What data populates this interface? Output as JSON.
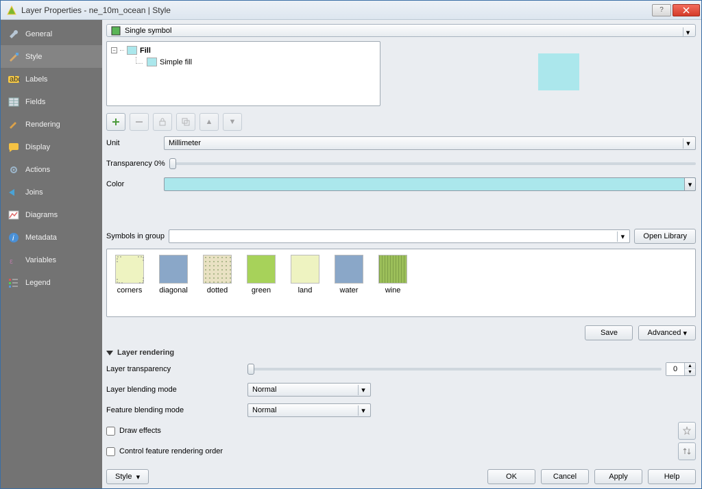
{
  "window": {
    "title": "Layer Properties - ne_10m_ocean | Style"
  },
  "sidebar": {
    "items": [
      {
        "label": "General"
      },
      {
        "label": "Style"
      },
      {
        "label": "Labels"
      },
      {
        "label": "Fields"
      },
      {
        "label": "Rendering"
      },
      {
        "label": "Display"
      },
      {
        "label": "Actions"
      },
      {
        "label": "Joins"
      },
      {
        "label": "Diagrams"
      },
      {
        "label": "Metadata"
      },
      {
        "label": "Variables"
      },
      {
        "label": "Legend"
      }
    ],
    "active_index": 1
  },
  "renderer": {
    "type": "Single symbol"
  },
  "tree": {
    "root": "Fill",
    "child": "Simple fill"
  },
  "colors": {
    "ocean": "#abe7ec"
  },
  "form": {
    "unit_label": "Unit",
    "unit_value": "Millimeter",
    "transparency_label": "Transparency 0%",
    "color_label": "Color"
  },
  "symbolsGroup": {
    "label": "Symbols in group",
    "openLibrary": "Open Library",
    "items": [
      {
        "name": "corners",
        "bg": "#eef3c1",
        "pattern": "corners"
      },
      {
        "name": "diagonal",
        "bg": "#8aa7c8",
        "pattern": ""
      },
      {
        "name": "dotted",
        "bg": "#e9e1c3",
        "pattern": "dots"
      },
      {
        "name": "green",
        "bg": "#a7d25a",
        "pattern": ""
      },
      {
        "name": "land",
        "bg": "#eef3c1",
        "pattern": ""
      },
      {
        "name": "water",
        "bg": "#8aa7c8",
        "pattern": ""
      },
      {
        "name": "wine",
        "bg": "#9cbf5a",
        "pattern": "lines"
      }
    ]
  },
  "buttons": {
    "save": "Save",
    "advanced": "Advanced"
  },
  "layerRendering": {
    "header": "Layer rendering",
    "transparency_label": "Layer transparency",
    "transparency_value": "0",
    "blend_label": "Layer blending mode",
    "blend_value": "Normal",
    "feat_blend_label": "Feature blending mode",
    "feat_blend_value": "Normal",
    "draw_effects": "Draw effects",
    "control_order": "Control feature rendering order"
  },
  "footer": {
    "style": "Style",
    "ok": "OK",
    "cancel": "Cancel",
    "apply": "Apply",
    "help": "Help"
  }
}
